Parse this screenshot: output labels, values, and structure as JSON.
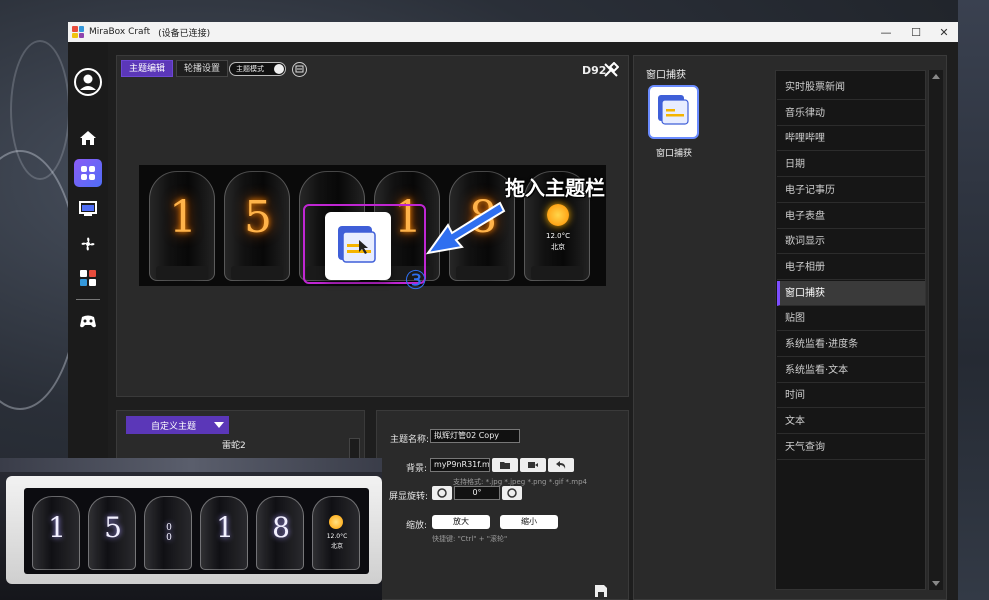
{
  "window": {
    "app_name": "MiraBox Craft",
    "status": "(设备已连接)"
  },
  "titlebar": {
    "minimize": "—",
    "maximize": "☐",
    "close": "✕"
  },
  "sidebar": [
    "user-avatar",
    "home",
    "themes",
    "screen",
    "fan",
    "plugins",
    "controller"
  ],
  "editor": {
    "tabs": [
      {
        "label": "主题编辑",
        "active": true
      },
      {
        "label": "轮播设置",
        "active": false
      }
    ],
    "mode_label": "主题模式",
    "device_label": "D92",
    "preview_digits": [
      "1",
      "5",
      "",
      "1",
      "8"
    ],
    "weather": {
      "temp": "12.0°C",
      "city": "北京"
    },
    "annotation_text": "拖入主题栏",
    "step_number": "③"
  },
  "theme_panel": {
    "dropdown_label": "自定义主题",
    "theme_name": "雷蛇2"
  },
  "settings": {
    "name_label": "主题名称:",
    "name_value": "拟辉灯管02 Copy",
    "bg_label": "背景:",
    "bg_value": "myP9nR31f.mp4",
    "formats_hint": "支持格式: *.jpg *.jpeg *.png *.gif *.mp4",
    "rotate_label": "屏显旋转:",
    "rotate_value": "0°",
    "zoom_label": "缩放:",
    "zoom_in": "放大",
    "zoom_out": "缩小",
    "shortcut_hint": "快捷键: \"Ctrl\" + \"滚轮\""
  },
  "component": {
    "section_title": "窗口捕获",
    "item_label": "窗口捕获"
  },
  "component_list": [
    {
      "label": "实时股票新闻",
      "active": false
    },
    {
      "label": "音乐律动",
      "active": false
    },
    {
      "label": "哔哩哔哩",
      "active": false
    },
    {
      "label": "日期",
      "active": false
    },
    {
      "label": "电子记事历",
      "active": false
    },
    {
      "label": "电子表盘",
      "active": false
    },
    {
      "label": "歌词显示",
      "active": false
    },
    {
      "label": "电子相册",
      "active": false
    },
    {
      "label": "窗口捕获",
      "active": true
    },
    {
      "label": "贴图",
      "active": false
    },
    {
      "label": "系统监看·进度条",
      "active": false
    },
    {
      "label": "系统监看·文本",
      "active": false
    },
    {
      "label": "时间",
      "active": false
    },
    {
      "label": "文本",
      "active": false
    },
    {
      "label": "天气查询",
      "active": false
    }
  ],
  "video_overlay": {
    "digits": [
      "1",
      "5",
      "0\n0",
      "1",
      "8"
    ],
    "weather": {
      "temp": "12.0°C",
      "city": "北京"
    }
  },
  "colors": {
    "accent": "#5b37b8",
    "highlight_border": "#c026d3",
    "arrow": "#2f6ff0"
  }
}
